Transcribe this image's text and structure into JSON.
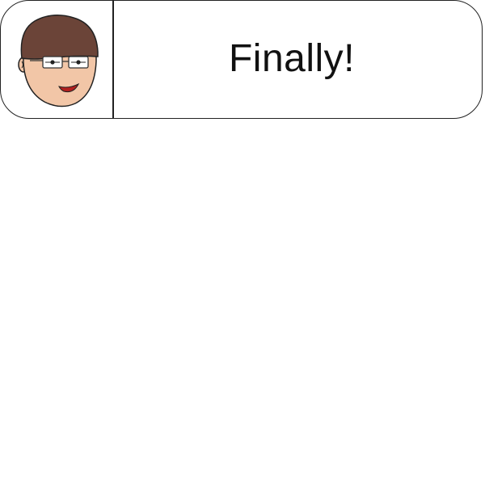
{
  "dialog": {
    "text": "Finally!",
    "portrait": {
      "icon": "character-face-icon",
      "hair_color": "#6b4438",
      "skin_color": "#f2c6a7",
      "mouth_color": "#b3201f"
    }
  },
  "colors": {
    "border": "#222222",
    "background": "#ffffff",
    "text": "#111111"
  }
}
